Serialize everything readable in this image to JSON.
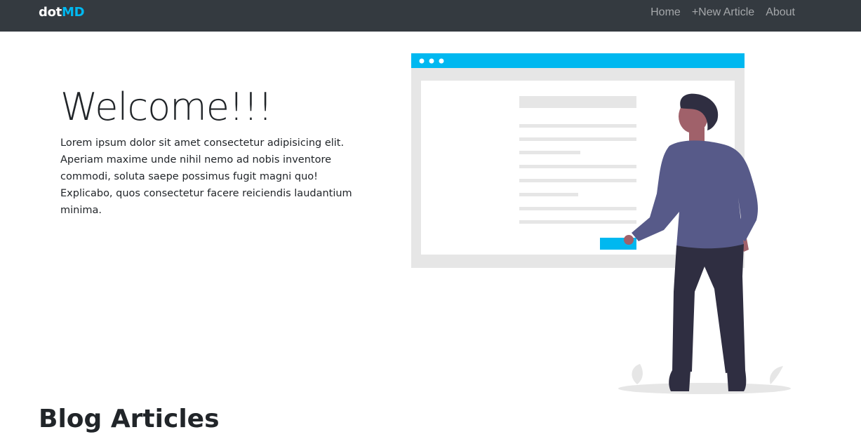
{
  "navbar": {
    "brand_part1": "dot",
    "brand_part2": "MD",
    "links": [
      {
        "label": "Home"
      },
      {
        "label": "+New Article"
      },
      {
        "label": "About"
      }
    ]
  },
  "hero": {
    "title": "Welcome!!!",
    "text": "Lorem ipsum dolor sit amet consectetur adipisicing elit. Aperiam maxime unde nihil nemo ad nobis inventore commodi, soluta saepe possimus fugit magni quo! Explicabo, quos consectetur facere reiciendis laudantium minima."
  },
  "illustration": {
    "name": "person-viewing-webpage-illustration",
    "accent_color": "#00b8f0",
    "shirt_color": "#575a89",
    "pants_color": "#2f2e41"
  },
  "articles_section": {
    "title": "Blog Articles"
  }
}
